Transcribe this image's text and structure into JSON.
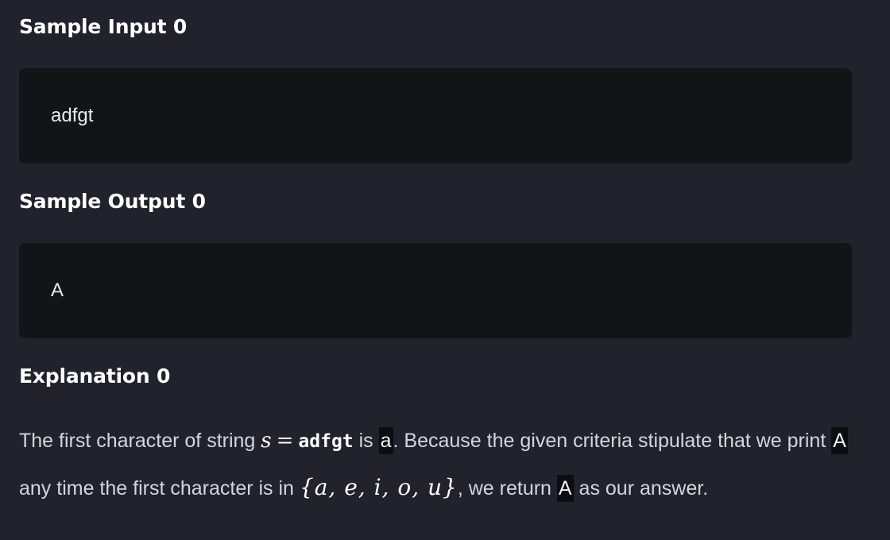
{
  "sample_input": {
    "heading": "Sample Input 0",
    "content": "adfgt"
  },
  "sample_output": {
    "heading": "Sample Output 0",
    "content": "A"
  },
  "explanation": {
    "heading": "Explanation 0",
    "t1": "The first character of string ",
    "var_s": "s",
    "eq": "=",
    "value": "adfgt",
    "t2": " is ",
    "code1": "a",
    "t3": ". Because the given criteria stipulate that we print ",
    "code2": "A",
    "t4": " any time the first character is in ",
    "set": "{a, e, i, o, u}",
    "t5": ", we return ",
    "code3": "A",
    "t6": " as our answer."
  }
}
